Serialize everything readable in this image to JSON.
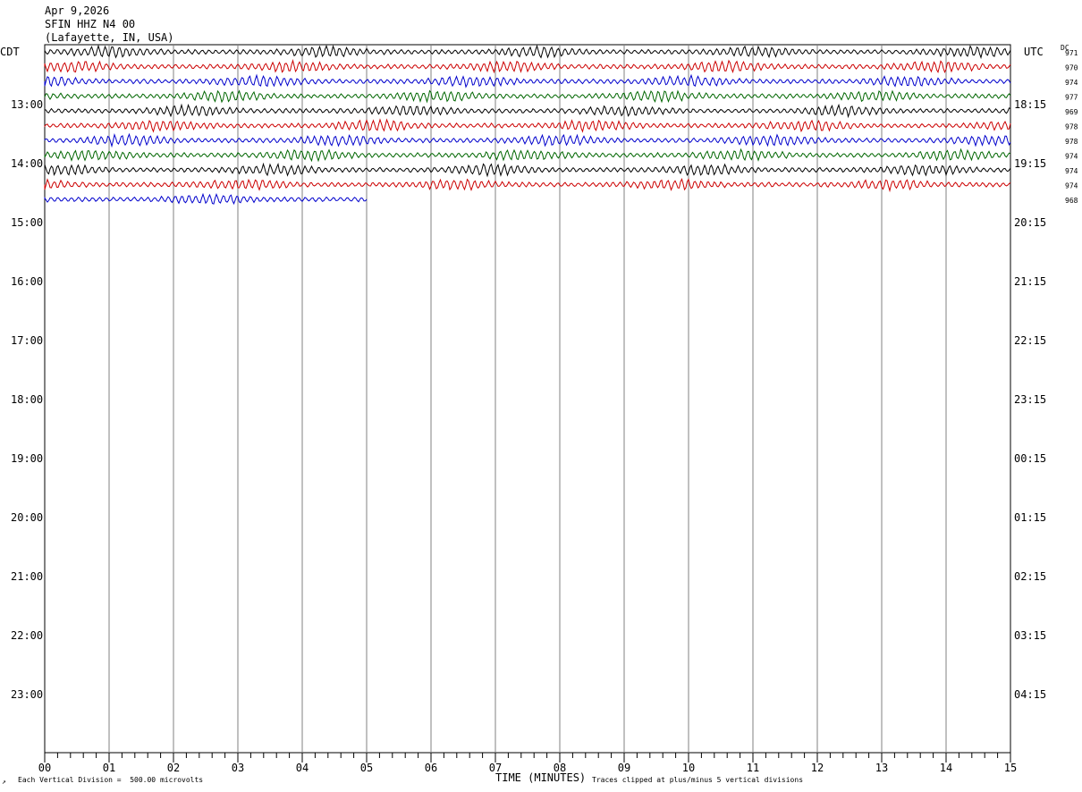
{
  "header": {
    "date": "Apr 9,2026",
    "station": "SFIN HHZ N4 00",
    "location": "(Lafayette, IN, USA)"
  },
  "left_axis_label": "CDT",
  "right_axis_label": "UTC",
  "dc_label": "DC",
  "footer": {
    "vertical_division": "Each Vertical Division =  500.00 microvolts",
    "x_axis_title": "TIME (MINUTES)",
    "clip_note": "Traces clipped at plus/minus 5 vertical divisions"
  },
  "chart_data": {
    "type": "line",
    "title": "SFIN HHZ N4 00",
    "xlabel": "TIME (MINUTES)",
    "ylabel": "",
    "xlim": [
      0,
      15
    ],
    "x_ticks": [
      "00",
      "01",
      "02",
      "03",
      "04",
      "05",
      "06",
      "07",
      "08",
      "09",
      "10",
      "11",
      "12",
      "13",
      "14",
      "15"
    ],
    "left_time_labels": [
      "13:00",
      "14:00",
      "15:00",
      "16:00",
      "17:00",
      "18:00",
      "19:00",
      "20:00",
      "21:00",
      "22:00",
      "23:00"
    ],
    "right_time_labels": [
      "18:15",
      "19:15",
      "20:15",
      "21:15",
      "22:15",
      "23:15",
      "00:15",
      "01:15",
      "02:15",
      "03:15",
      "04:15"
    ],
    "rows_per_hour": 4,
    "minutes_per_row": 15,
    "trace_colors": [
      "#000000",
      "#cc0000",
      "#0000cc",
      "#006600"
    ],
    "series": [
      {
        "row": 0,
        "color": "#000000",
        "dc_offset": "971",
        "end_minute": 15
      },
      {
        "row": 1,
        "color": "#cc0000",
        "dc_offset": "970",
        "end_minute": 15
      },
      {
        "row": 2,
        "color": "#0000cc",
        "dc_offset": "974",
        "end_minute": 15
      },
      {
        "row": 3,
        "color": "#006600",
        "dc_offset": "977",
        "end_minute": 15
      },
      {
        "row": 4,
        "color": "#000000",
        "dc_offset": "969",
        "end_minute": 15
      },
      {
        "row": 5,
        "color": "#cc0000",
        "dc_offset": "978",
        "end_minute": 15
      },
      {
        "row": 6,
        "color": "#0000cc",
        "dc_offset": "978",
        "end_minute": 15
      },
      {
        "row": 7,
        "color": "#006600",
        "dc_offset": "974",
        "end_minute": 15
      },
      {
        "row": 8,
        "color": "#000000",
        "dc_offset": "974",
        "end_minute": 15
      },
      {
        "row": 9,
        "color": "#cc0000",
        "dc_offset": "974",
        "end_minute": 15
      },
      {
        "row": 10,
        "color": "#0000cc",
        "dc_offset": "968",
        "end_minute": 5
      }
    ],
    "vertical_division_microvolts": 500.0,
    "clip_divisions": 5
  }
}
